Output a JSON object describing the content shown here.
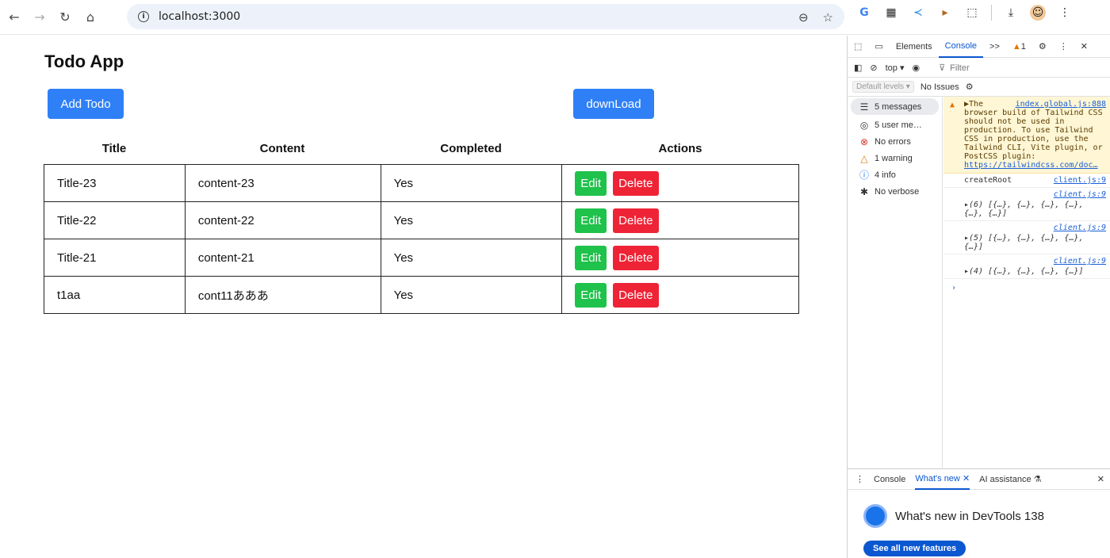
{
  "browser": {
    "url": "localhost:3000"
  },
  "app": {
    "title": "Todo App",
    "add_button": "Add Todo",
    "download_button": "downLoad",
    "columns": [
      "Title",
      "Content",
      "Completed",
      "Actions"
    ],
    "rows": [
      {
        "title": "Title-23",
        "content": "content-23",
        "completed": "Yes"
      },
      {
        "title": "Title-22",
        "content": "content-22",
        "completed": "Yes"
      },
      {
        "title": "Title-21",
        "content": "content-21",
        "completed": "Yes"
      },
      {
        "title": "t1aa",
        "content": "cont11あああ",
        "completed": "Yes"
      }
    ],
    "edit_label": "Edit",
    "delete_label": "Delete"
  },
  "devtools": {
    "tabs": [
      "Elements",
      "Console"
    ],
    "active_tab": "Console",
    "more": ">>",
    "warning_count": "1",
    "context": "top ▾",
    "filter": "Filter",
    "levels": "Default levels ▾",
    "issues": "No Issues",
    "sidebar": [
      {
        "label": "5 messages",
        "icon": "list-icon"
      },
      {
        "label": "5 user me…",
        "icon": "user-icon"
      },
      {
        "label": "No errors",
        "icon": "error-icon"
      },
      {
        "label": "1 warning",
        "icon": "warning-icon"
      },
      {
        "label": "4 info",
        "icon": "info-icon"
      },
      {
        "label": "No verbose",
        "icon": "bug-icon"
      }
    ],
    "warning": {
      "prefix": "▶The",
      "source": "index.global.js:888",
      "text": "browser build of Tailwind CSS should not be used in production. To use Tailwind CSS in production, use the Tailwind CLI, Vite plugin, or PostCSS plugin:",
      "link": "https://tailwindcss.com/doc…"
    },
    "messages": [
      {
        "text": "createRoot",
        "source": "client.js:9"
      },
      {
        "text": "▸(6) [{…}, {…}, {…}, {…}, {…}, {…}]",
        "source": "client.js:9"
      },
      {
        "text": "▸(5) [{…}, {…}, {…}, {…}, {…}]",
        "source": "client.js:9"
      },
      {
        "text": "▸(4) [{…}, {…}, {…}, {…}]",
        "source": "client.js:9"
      }
    ],
    "prompt": "›",
    "drawer": {
      "tabs": [
        "Console",
        "What's new",
        "AI assistance"
      ],
      "active": "What's new",
      "title": "What's new in DevTools 138",
      "button": "See all new features"
    }
  }
}
